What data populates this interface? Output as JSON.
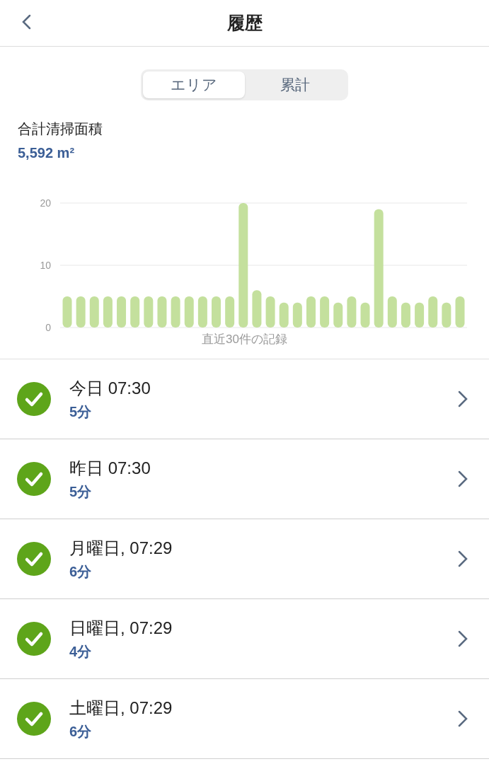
{
  "header": {
    "title": "履歴"
  },
  "tabs": [
    {
      "label": "エリア",
      "selected": true
    },
    {
      "label": "累計",
      "selected": false
    }
  ],
  "summary": {
    "label": "合計清掃面積",
    "value": "5,592 m²"
  },
  "chart": {
    "chart_data": {
      "type": "bar",
      "xlabel": "直近30件の記録",
      "ylim": [
        0,
        20
      ],
      "yticks": [
        0,
        10,
        20
      ],
      "values": [
        5,
        5,
        5,
        5,
        5,
        5,
        5,
        5,
        5,
        5,
        5,
        5,
        5,
        20,
        6,
        5,
        4,
        4,
        5,
        5,
        4,
        5,
        4,
        19,
        5,
        4,
        4,
        5,
        4,
        5
      ]
    }
  },
  "records": [
    {
      "title": "今日 07:30",
      "duration": "5分"
    },
    {
      "title": "昨日 07:30",
      "duration": "5分"
    },
    {
      "title": "月曜日, 07:29",
      "duration": "6分"
    },
    {
      "title": "日曜日, 07:29",
      "duration": "4分"
    },
    {
      "title": "土曜日, 07:29",
      "duration": "6分"
    }
  ]
}
